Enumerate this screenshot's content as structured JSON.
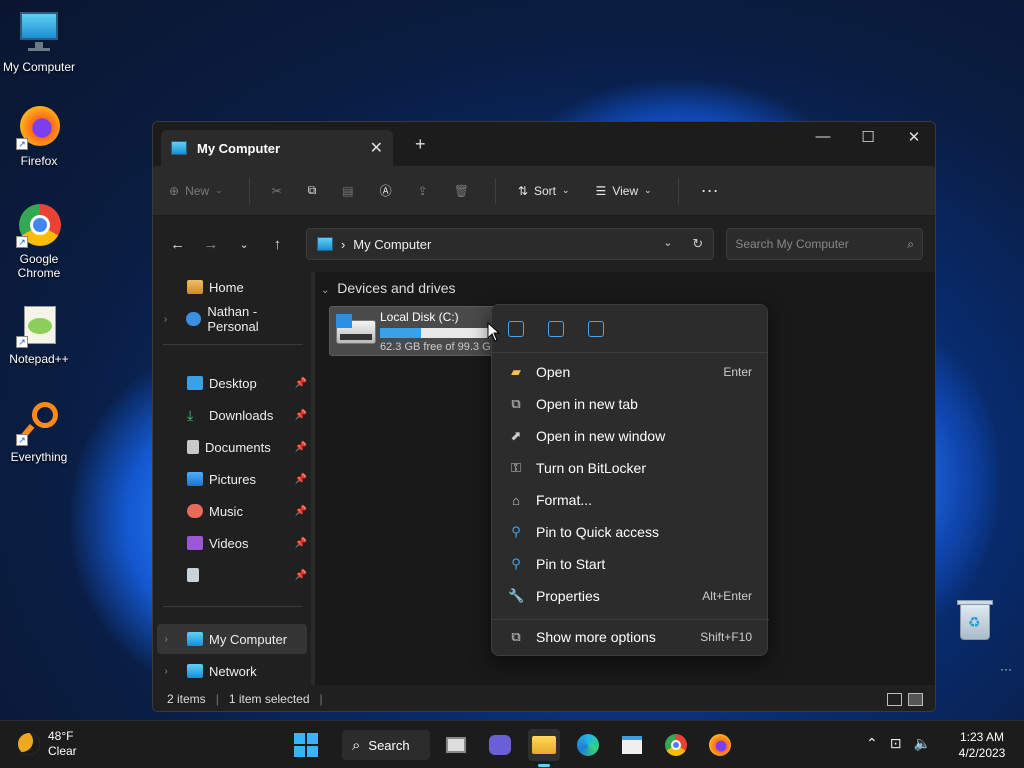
{
  "desktop": {
    "icons": [
      {
        "label": "My Computer"
      },
      {
        "label": "Firefox"
      },
      {
        "label": "Google Chrome"
      },
      {
        "label": "Notepad++"
      },
      {
        "label": "Everything"
      }
    ]
  },
  "window": {
    "tab_title": "My Computer",
    "toolbar": {
      "new_label": "New",
      "sort_label": "Sort",
      "view_label": "View"
    },
    "address": {
      "path": "My Computer"
    },
    "search": {
      "placeholder": "Search My Computer"
    },
    "sidebar": {
      "items": [
        {
          "label": "Home"
        },
        {
          "label": "Nathan - Personal"
        },
        {
          "label": "Desktop"
        },
        {
          "label": "Downloads"
        },
        {
          "label": "Documents"
        },
        {
          "label": "Pictures"
        },
        {
          "label": "Music"
        },
        {
          "label": "Videos"
        },
        {
          "label": ""
        },
        {
          "label": "My Computer"
        },
        {
          "label": "Network"
        }
      ]
    },
    "content": {
      "section_title": "Devices and drives",
      "drive": {
        "name": "Local Disk (C:)",
        "free_text": "62.3 GB free of 99.3 GB",
        "used_fraction": 0.37
      }
    },
    "status": {
      "items_count": "2 items",
      "selected": "1 item selected"
    }
  },
  "context_menu": {
    "items": [
      {
        "label": "Open",
        "shortcut": "Enter",
        "icon": "folder-icon"
      },
      {
        "label": "Open in new tab",
        "shortcut": "",
        "icon": "new-tab-icon"
      },
      {
        "label": "Open in new window",
        "shortcut": "",
        "icon": "new-window-icon"
      },
      {
        "label": "Turn on BitLocker",
        "shortcut": "",
        "icon": "key-icon"
      },
      {
        "label": "Format...",
        "shortcut": "",
        "icon": "format-icon"
      },
      {
        "label": "Pin to Quick access",
        "shortcut": "",
        "icon": "pin-icon"
      },
      {
        "label": "Pin to Start",
        "shortcut": "",
        "icon": "pin-icon"
      },
      {
        "label": "Properties",
        "shortcut": "Alt+Enter",
        "icon": "wrench-icon"
      },
      {
        "label": "Show more options",
        "shortcut": "Shift+F10",
        "icon": "more-options-icon"
      }
    ]
  },
  "taskbar": {
    "weather_temp": "48°F",
    "weather_desc": "Clear",
    "search_label": "Search",
    "time": "1:23 AM",
    "date": "4/2/2023"
  },
  "colors": {
    "accent": "#60cdff",
    "drive_fill": "#3aa0e8"
  }
}
